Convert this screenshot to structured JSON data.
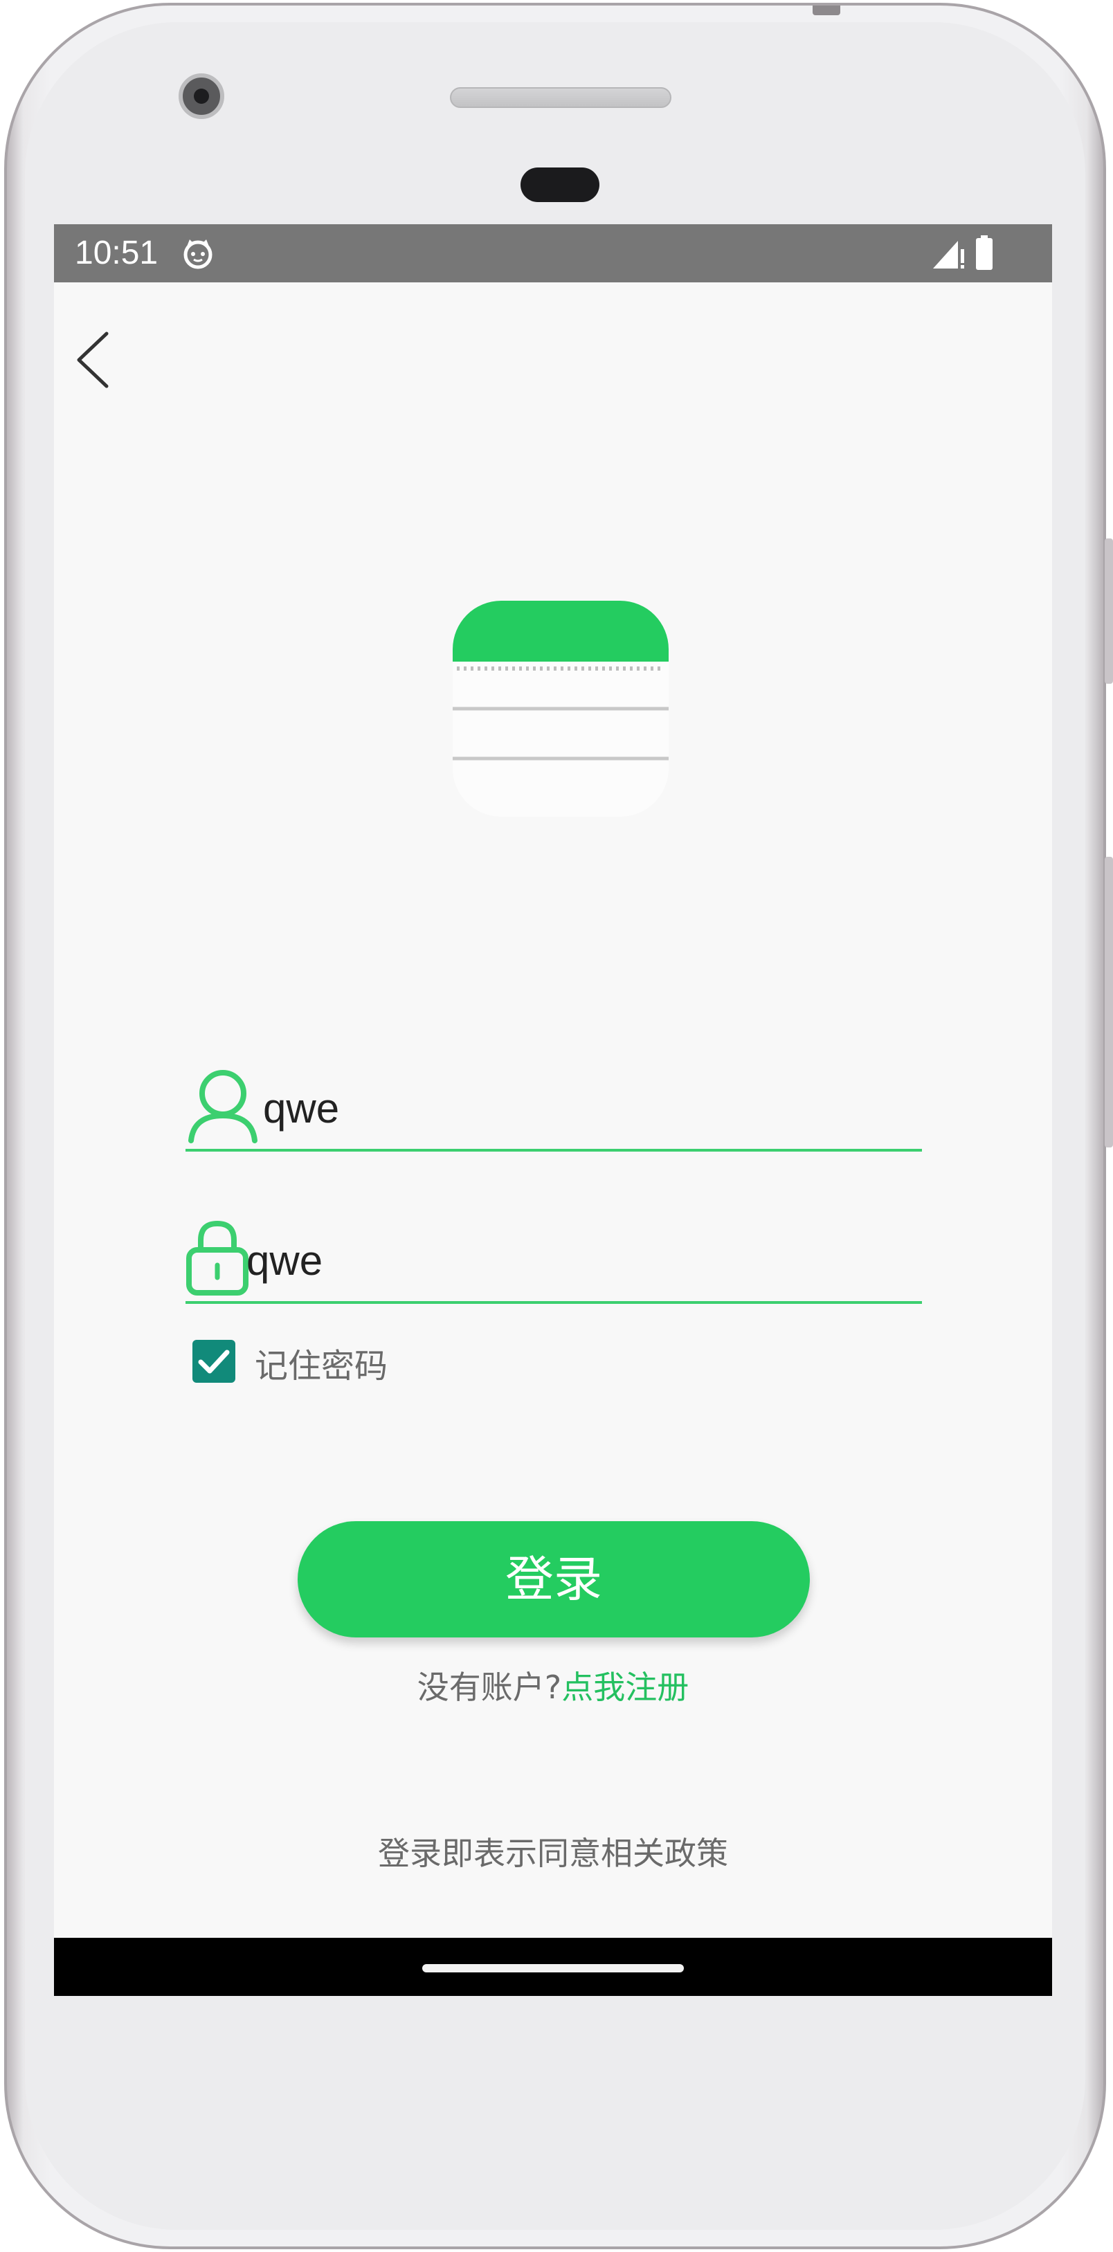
{
  "status_bar": {
    "time": "10:51",
    "background": "#777777",
    "icons": [
      "status-face-icon",
      "cell-signal-icon",
      "battery-icon"
    ]
  },
  "navigation": {
    "back_icon": "back-arrow-icon"
  },
  "logo": {
    "icon": "notebook-icon",
    "accent": "#24cc60"
  },
  "login_form": {
    "username": {
      "icon": "user-icon",
      "value": "qwe"
    },
    "password": {
      "icon": "lock-icon",
      "value": "qwe"
    },
    "remember_password": {
      "label": "记住密码",
      "checked": true,
      "color": "#118a7a"
    },
    "login_button": "登录",
    "register_prompt": "没有账户?",
    "register_link": "点我注册",
    "policy_text": "登录即表示同意相关政策"
  },
  "theme": {
    "primary": "#24cc60",
    "text_secondary": "#6a6a6a",
    "screen_background": "#f8f8f8"
  }
}
